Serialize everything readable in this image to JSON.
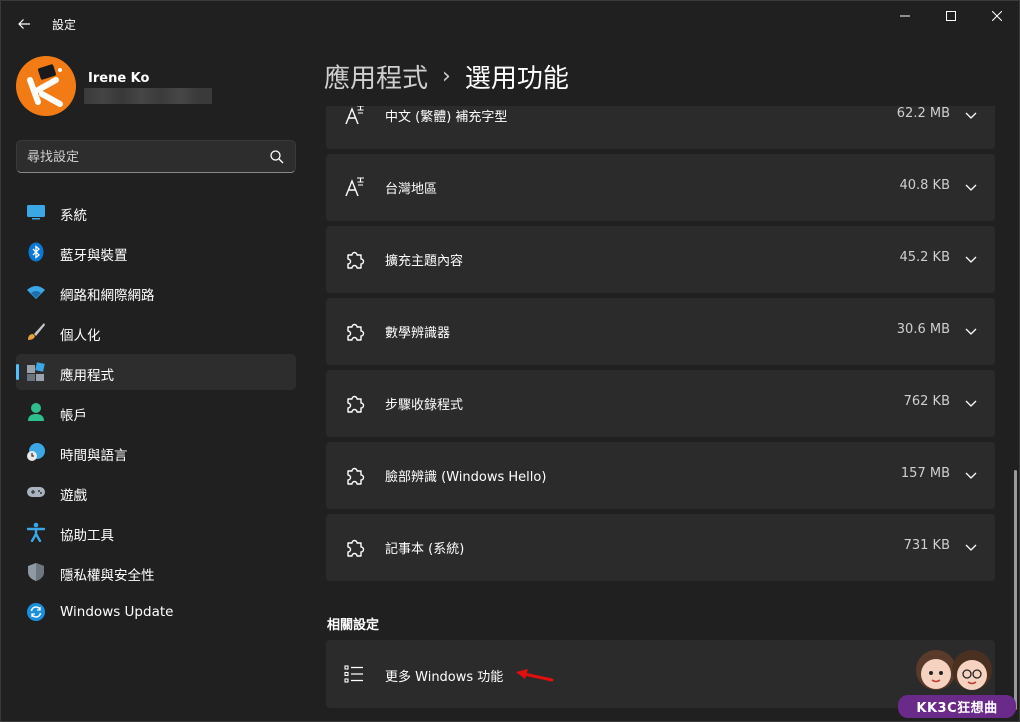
{
  "window": {
    "title": "設定"
  },
  "profile": {
    "name": "Irene Ko"
  },
  "search": {
    "placeholder": "尋找設定"
  },
  "sidebar": {
    "items": [
      {
        "label": "系統",
        "icon": "system-icon"
      },
      {
        "label": "藍牙與裝置",
        "icon": "bluetooth-icon"
      },
      {
        "label": "網路和網際網路",
        "icon": "wifi-icon"
      },
      {
        "label": "個人化",
        "icon": "paintbrush-icon"
      },
      {
        "label": "應用程式",
        "icon": "apps-icon",
        "selected": true
      },
      {
        "label": "帳戶",
        "icon": "account-icon"
      },
      {
        "label": "時間與語言",
        "icon": "time-language-icon"
      },
      {
        "label": "遊戲",
        "icon": "gamepad-icon"
      },
      {
        "label": "協助工具",
        "icon": "accessibility-icon"
      },
      {
        "label": "隱私權與安全性",
        "icon": "shield-icon"
      },
      {
        "label": "Windows Update",
        "icon": "update-icon"
      }
    ]
  },
  "header": {
    "parent": "應用程式",
    "separator": "›",
    "current": "選用功能"
  },
  "features": [
    {
      "name": "中文 (繁體) 補充字型",
      "size": "62.2 MB",
      "icon": "font-icon"
    },
    {
      "name": "台灣地區",
      "size": "40.8 KB",
      "icon": "font-icon"
    },
    {
      "name": "擴充主題內容",
      "size": "45.2 KB",
      "icon": "puzzle-icon"
    },
    {
      "name": "數學辨識器",
      "size": "30.6 MB",
      "icon": "puzzle-icon"
    },
    {
      "name": "步驟收錄程式",
      "size": "762 KB",
      "icon": "puzzle-icon"
    },
    {
      "name": "臉部辨識 (Windows Hello)",
      "size": "157 MB",
      "icon": "puzzle-icon"
    },
    {
      "name": "記事本 (系統)",
      "size": "731 KB",
      "icon": "puzzle-icon"
    }
  ],
  "related": {
    "title": "相關設定",
    "item_label": "更多 Windows 功能",
    "item_icon": "list-icon"
  },
  "watermark": {
    "text": "KK3C狂想曲"
  },
  "colors": {
    "background": "#202020",
    "card": "#2b2b2b",
    "accent": "#4cc2ff",
    "annotation_arrow": "#e01010"
  }
}
